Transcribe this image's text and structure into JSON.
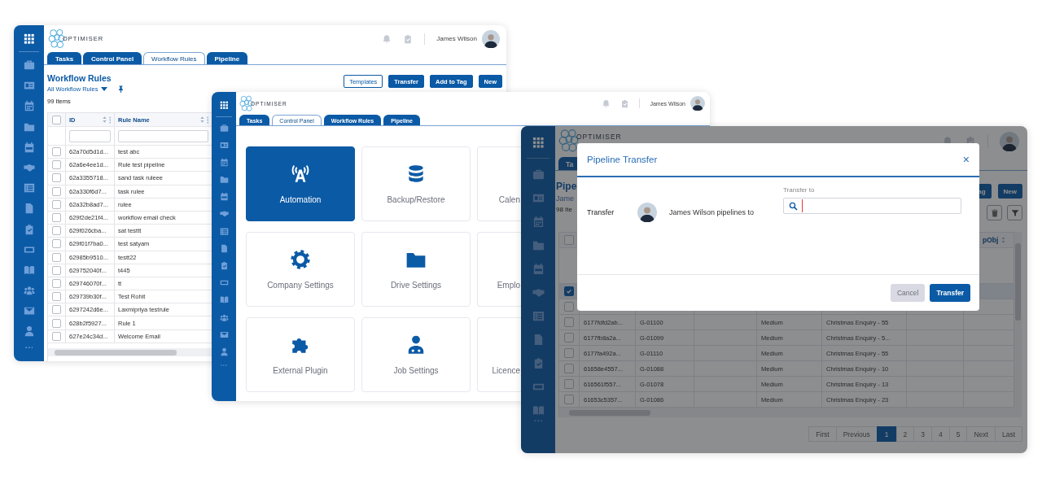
{
  "workflow_window": {
    "logo": "OPTIMISER",
    "user_name": "James Wilson",
    "tabs": [
      {
        "label": "Tasks",
        "selected": false
      },
      {
        "label": "Control Panel",
        "selected": false
      },
      {
        "label": "Workflow Rules",
        "selected": true
      },
      {
        "label": "Pipeline",
        "selected": false
      }
    ],
    "title": "Workflow Rules",
    "view": "All Workflow Rules",
    "count": "99 Items",
    "buttons": [
      {
        "label": "Templates",
        "kind": "outline"
      },
      {
        "label": "Transfer",
        "kind": "primary"
      },
      {
        "label": "Add to Tag",
        "kind": "primary"
      },
      {
        "label": "New",
        "kind": "primary"
      }
    ],
    "table": {
      "all_checked": false,
      "columns": [
        "ID",
        "Rule Name"
      ],
      "rows": [
        {
          "checked": false,
          "cells": [
            "62a70d5d1d...",
            "test abc"
          ]
        },
        {
          "checked": false,
          "cells": [
            "62a6e4ee1d...",
            "Rule test pipeline"
          ]
        },
        {
          "checked": false,
          "cells": [
            "62a3355718...",
            "sand task ruleee"
          ]
        },
        {
          "checked": false,
          "cells": [
            "62a330f6d7...",
            "task rulee"
          ]
        },
        {
          "checked": false,
          "cells": [
            "62a32b8ad7...",
            "rulee"
          ]
        },
        {
          "checked": false,
          "cells": [
            "629f2de21f4...",
            "workflow email check"
          ]
        },
        {
          "checked": false,
          "cells": [
            "629f026cba...",
            "sat testtt"
          ]
        },
        {
          "checked": false,
          "cells": [
            "629f01f7ba0...",
            "test satyam"
          ]
        },
        {
          "checked": false,
          "cells": [
            "62985b9510...",
            "testt22"
          ]
        },
        {
          "checked": false,
          "cells": [
            "629752040f...",
            "t445"
          ]
        },
        {
          "checked": false,
          "cells": [
            "629746070f...",
            "tt"
          ]
        },
        {
          "checked": false,
          "cells": [
            "629739b30f...",
            "Test Rohit"
          ]
        },
        {
          "checked": false,
          "cells": [
            "6297242d6e...",
            "Laxmipriya testrule"
          ]
        },
        {
          "checked": false,
          "cells": [
            "628b2f5927...",
            "Rule 1"
          ]
        },
        {
          "checked": false,
          "cells": [
            "627e24c34d...",
            "Welcome Email"
          ]
        }
      ]
    }
  },
  "control_panel_window": {
    "logo": "OPTIMISER",
    "user_name": "James Wilson",
    "tabs": [
      {
        "label": "Tasks",
        "selected": false
      },
      {
        "label": "Control Panel",
        "selected": true
      },
      {
        "label": "Workflow Rules",
        "selected": false
      },
      {
        "label": "Pipeline",
        "selected": false
      }
    ],
    "tiles": [
      {
        "label": "Automation",
        "selected": true
      },
      {
        "label": "Backup/Restore",
        "selected": false
      },
      {
        "label": "Calen",
        "selected": false
      },
      {
        "label": "Company Settings",
        "selected": false
      },
      {
        "label": "Drive Settings",
        "selected": false
      },
      {
        "label": "Emplo",
        "selected": false
      },
      {
        "label": "External Plugin",
        "selected": false
      },
      {
        "label": "Job Settings",
        "selected": false
      },
      {
        "label": "Licence",
        "selected": false
      }
    ]
  },
  "pipeline_window": {
    "logo": "OPTIMISER",
    "tabs": [
      {
        "label": "Ta",
        "selected": false
      }
    ],
    "title": "Pipe",
    "subtitle": "Jame",
    "count": "98 Ite",
    "buttons": [
      {
        "label": "ag"
      },
      {
        "label": "New"
      }
    ],
    "table": {
      "all_checked": false,
      "last_column": "pObj",
      "rows": [
        {
          "checked": true,
          "selected": true
        },
        {
          "checked": false,
          "selected": false
        },
        {
          "checked": false,
          "selected": false,
          "id": "6177fdfd2ab...",
          "code": "G-01100",
          "priority": "Medium",
          "name": "Christmas Enquiry - 55"
        },
        {
          "checked": false,
          "selected": false,
          "id": "6177fb8a2a...",
          "code": "G-01099",
          "priority": "Medium",
          "name": "Christmas Enquiry - 5..."
        },
        {
          "checked": false,
          "selected": false,
          "id": "6177fa492a...",
          "code": "G-01110",
          "priority": "Medium",
          "name": "Christmas Enquiry - 55"
        },
        {
          "checked": false,
          "selected": false,
          "id": "61658e4557...",
          "code": "G-01088",
          "priority": "Medium",
          "name": "Christmas Enquiry - 10"
        },
        {
          "checked": false,
          "selected": false,
          "id": "616561f557...",
          "code": "G-01078",
          "priority": "Medium",
          "name": "Christmas Enquiry - 13"
        },
        {
          "checked": false,
          "selected": false,
          "id": "61653c5357...",
          "code": "G-01086",
          "priority": "Medium",
          "name": "Christmas Enquiry - 23"
        }
      ]
    },
    "pagination": [
      {
        "label": "First",
        "selected": false
      },
      {
        "label": "Previous",
        "selected": false
      },
      {
        "label": "1",
        "selected": true
      },
      {
        "label": "2",
        "selected": false
      },
      {
        "label": "3",
        "selected": false
      },
      {
        "label": "4",
        "selected": false
      },
      {
        "label": "5",
        "selected": false
      },
      {
        "label": "Next",
        "selected": false
      },
      {
        "label": "Last",
        "selected": false
      }
    ],
    "modal": {
      "title": "Pipeline Transfer",
      "close": "×",
      "label": "Transfer",
      "user_text": "James Wilson pipelines to",
      "field_label": "Transfer to",
      "focused": true,
      "buttons": [
        {
          "label": "Cancel",
          "kind": "secondary"
        },
        {
          "label": "Transfer",
          "kind": "primary"
        }
      ]
    }
  }
}
